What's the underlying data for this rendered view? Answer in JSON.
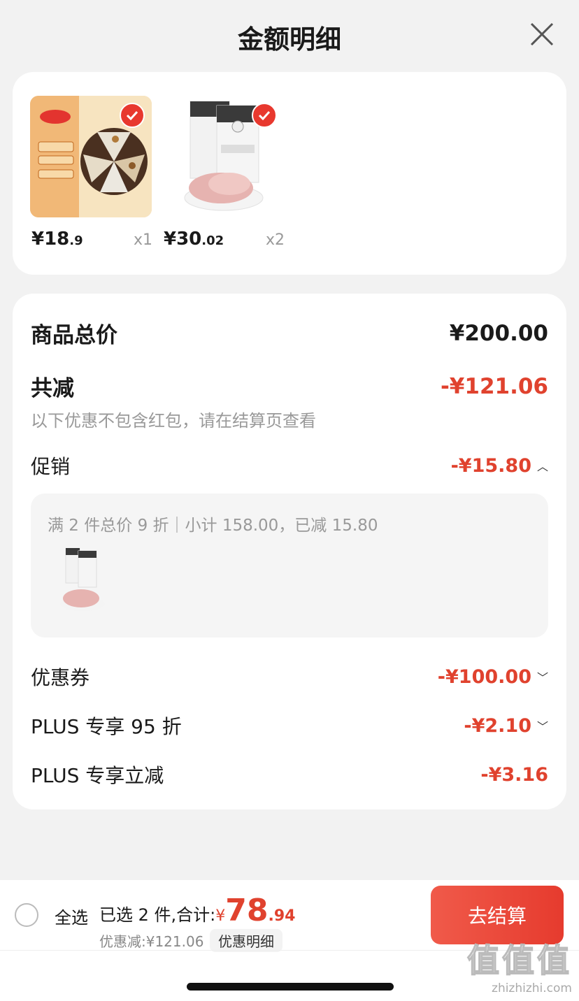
{
  "header": {
    "title": "金额明细"
  },
  "products": [
    {
      "price_int": "¥18",
      "price_dec": ".9",
      "qty": "x1"
    },
    {
      "price_int": "¥30",
      "price_dec": ".02",
      "qty": "x2"
    }
  ],
  "summary": {
    "total_label": "商品总价",
    "total_value": "¥200.00",
    "reduce_label": "共减",
    "reduce_value": "-¥121.06",
    "note": "以下优惠不包含红包，请在结算页查看",
    "promo_label": "促销",
    "promo_value": "-¥15.80",
    "promo_detail": "满 2 件总价 9 折｜小计 158.00，已减 15.80",
    "coupon_label": "优惠券",
    "coupon_value": "-¥100.00",
    "plus95_label": "PLUS 专享 95 折",
    "plus95_value": "-¥2.10",
    "plusreduce_label": "PLUS 专享立减",
    "plusreduce_value": "-¥3.16"
  },
  "footer": {
    "select_all": "全选",
    "selected_prefix": "已选 2 件,合计:",
    "currency": "¥",
    "total_int": "78",
    "total_dec": ".94",
    "saved": "优惠减:¥121.06",
    "detail_link": "优惠明细",
    "checkout": "去结算"
  },
  "watermark": {
    "big": "值值值",
    "small": "zhizhizhi.com"
  },
  "colors": {
    "accent": "#e0422e",
    "button": "#e63b2e"
  }
}
